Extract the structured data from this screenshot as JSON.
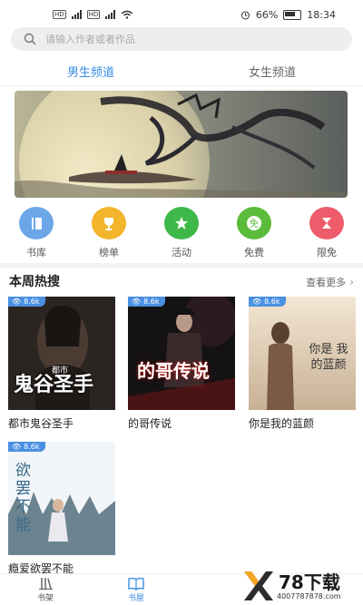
{
  "status_bar": {
    "battery": "66%",
    "time": "18:34"
  },
  "search": {
    "placeholder": "请输入作者或者作品"
  },
  "channels": [
    "男生频道",
    "女生频道"
  ],
  "quick_links": [
    {
      "label": "书库",
      "color": "#6ba7e8",
      "icon": "book-icon"
    },
    {
      "label": "榜单",
      "color": "#f2b52b",
      "icon": "trophy-icon"
    },
    {
      "label": "活动",
      "color": "#3fb84a",
      "icon": "star-icon"
    },
    {
      "label": "免费",
      "color": "#5bbb3a",
      "icon": "free-icon"
    },
    {
      "label": "限免",
      "color": "#ee5c6b",
      "icon": "hourglass-icon"
    }
  ],
  "section": {
    "title": "本周热搜",
    "more": "查看更多"
  },
  "books": [
    {
      "title": "都市鬼谷圣手",
      "views": "8.6k",
      "cover_text": "鬼谷圣手",
      "cover_sub": "都市"
    },
    {
      "title": "的哥传说",
      "views": "8.6k",
      "cover_text": "的哥传说",
      "cover_sub": ""
    },
    {
      "title": "你是我的蓝颜",
      "views": "8.6k",
      "cover_text": "你是 我的蓝颜",
      "cover_sub": ""
    },
    {
      "title": "瘾爱欲罢不能",
      "views": "8.6k",
      "cover_text": "欲罢不能",
      "cover_sub": ""
    }
  ],
  "bottom_nav": [
    {
      "label": "书架",
      "active": false
    },
    {
      "label": "书屋",
      "active": true
    }
  ],
  "watermark": {
    "brand": "78下载",
    "url": "4007787878.com"
  }
}
